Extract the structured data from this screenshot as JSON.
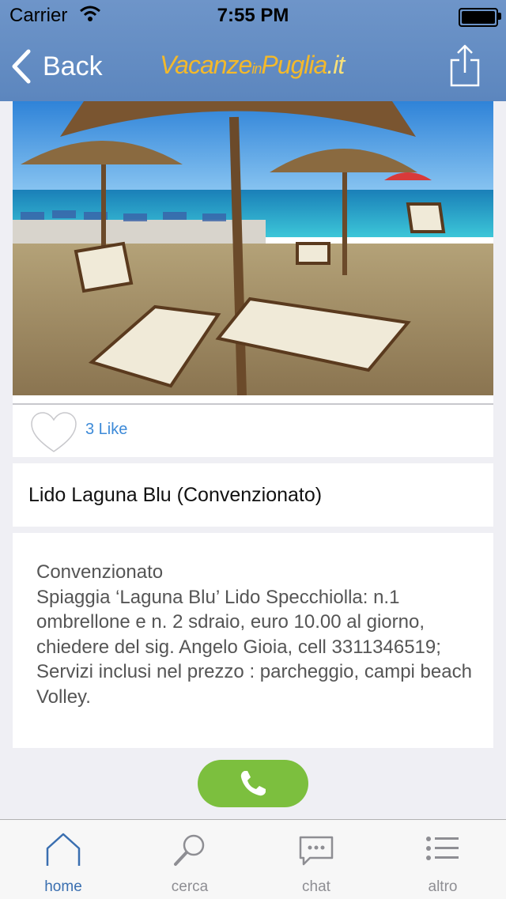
{
  "status_bar": {
    "carrier": "Carrier",
    "time": "7:55 PM"
  },
  "nav": {
    "back_label": "Back",
    "logo_parts": [
      "Vacanze",
      "in",
      "Puglia",
      ".it"
    ]
  },
  "like": {
    "count_label": "3 Like"
  },
  "listing": {
    "title": "Lido Laguna Blu (Convenzionato)",
    "description": "Convenzionato\nSpiaggia ‘Laguna Blu’ Lido Specchiolla:  n.1 ombrellone e n. 2 sdraio, euro 10.00 al giorno, chiedere del sig. Angelo Gioia, cell 3311346519; Servizi inclusi nel prezzo : parcheggio, campi beach Volley."
  },
  "tabs": [
    {
      "label": "home",
      "icon": "home-icon"
    },
    {
      "label": "cerca",
      "icon": "search-icon"
    },
    {
      "label": "chat",
      "icon": "chat-icon"
    },
    {
      "label": "altro",
      "icon": "list-icon"
    }
  ],
  "colors": {
    "nav": "#6389c2",
    "call": "#7cbf3e",
    "active_tab": "#3a6fb0",
    "like_text": "#3d8ad8"
  }
}
